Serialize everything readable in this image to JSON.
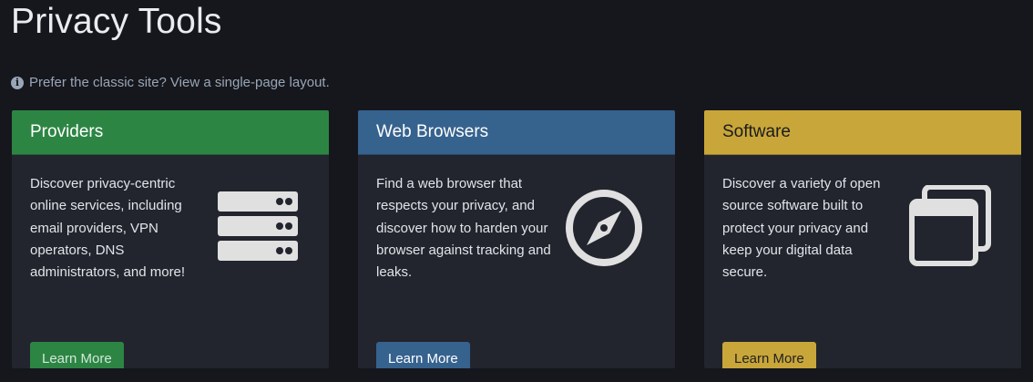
{
  "page": {
    "title": "Privacy Tools"
  },
  "notice": {
    "icon": "info-icon",
    "prefix": "Prefer the classic site?",
    "link_text": "View a single-page layout."
  },
  "cards": [
    {
      "header": "Providers",
      "text": "Discover privacy-centric online services, including email providers, VPN operators, DNS administrators, and more!",
      "icon": "server-icon",
      "button": "Learn More",
      "color": "#2d8544"
    },
    {
      "header": "Web Browsers",
      "text": "Find a web browser that respects your privacy, and discover how to harden your browser against tracking and leaks.",
      "icon": "compass-icon",
      "button": "Learn More",
      "color": "#36628e"
    },
    {
      "header": "Software",
      "text": "Discover a variety of open source software built to protect your privacy and keep your digital data secure.",
      "icon": "windows-icon",
      "button": "Learn More",
      "color": "#c8a63a"
    }
  ],
  "colors": {
    "background": "#15171d",
    "card_background": "#22252e",
    "icon": "#e0e0e0"
  }
}
